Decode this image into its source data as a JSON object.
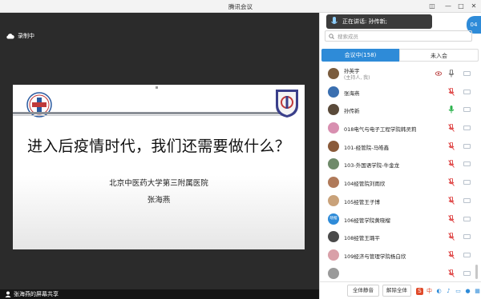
{
  "window": {
    "title": "腾讯会议",
    "minimize": "—",
    "maximize": "□",
    "close": "✕"
  },
  "share": {
    "recording_label": "录制中",
    "footer_label": "张海燕的屏幕共享"
  },
  "slide": {
    "headline": "进入后疫情时代，我们还需要做什么？",
    "institution": "北京中医药大学第三附属医院",
    "author": "张海燕"
  },
  "panel": {
    "speaking": "正在讲话: 孙传新;",
    "bubble": "04",
    "search_placeholder": "搜索成员",
    "tab_in_meeting": "会议中(158)",
    "tab_not_joined": "未入会",
    "participants": [
      {
        "name": "孙英宇",
        "sub": "(主持人, 我)",
        "avatar_color": "#7a5c3e",
        "mic": "on",
        "eye": true
      },
      {
        "name": "张海燕",
        "sub": "",
        "avatar_color": "#3a6fb0",
        "mic": "off",
        "eye": false
      },
      {
        "name": "孙传新",
        "sub": "",
        "avatar_color": "#5a4a3a",
        "mic": "active",
        "eye": false
      },
      {
        "name": "018电气与电子工程学院韩灵莉",
        "sub": "",
        "avatar_color": "#d88fb0",
        "mic": "off",
        "eye": false
      },
      {
        "name": "101-经管院-马皓鑫",
        "sub": "",
        "avatar_color": "#8a5a3a",
        "mic": "off",
        "eye": false
      },
      {
        "name": "103-外国语学院-牛金龙",
        "sub": "",
        "avatar_color": "#6f8a6a",
        "mic": "off",
        "eye": false
      },
      {
        "name": "104经管院刘雨欣",
        "sub": "",
        "avatar_color": "#b07a5a",
        "mic": "off",
        "eye": false
      },
      {
        "name": "105经管王子博",
        "sub": "",
        "avatar_color": "#c9a27a",
        "mic": "off",
        "eye": false
      },
      {
        "name": "106经管学院黄晓榴",
        "sub": "",
        "avatar_color": "#2e8bd8",
        "mic": "off",
        "eye": false,
        "avatar_text": "晓榴"
      },
      {
        "name": "108经管王璐平",
        "sub": "",
        "avatar_color": "#4a4a4a",
        "mic": "off",
        "eye": false
      },
      {
        "name": "109经济与管理学院杨白欣",
        "sub": "",
        "avatar_color": "#d9a0a8",
        "mic": "off",
        "eye": false
      },
      {
        "name": "",
        "sub": "",
        "avatar_color": "#9a9a9a",
        "mic": "off",
        "eye": false
      }
    ],
    "mute_all": "全体静音",
    "unmute_all": "解除全体"
  },
  "colors": {
    "accent": "#2e8bd8",
    "mic_off": "#e04a4a",
    "mic_on": "#2bb24c"
  }
}
